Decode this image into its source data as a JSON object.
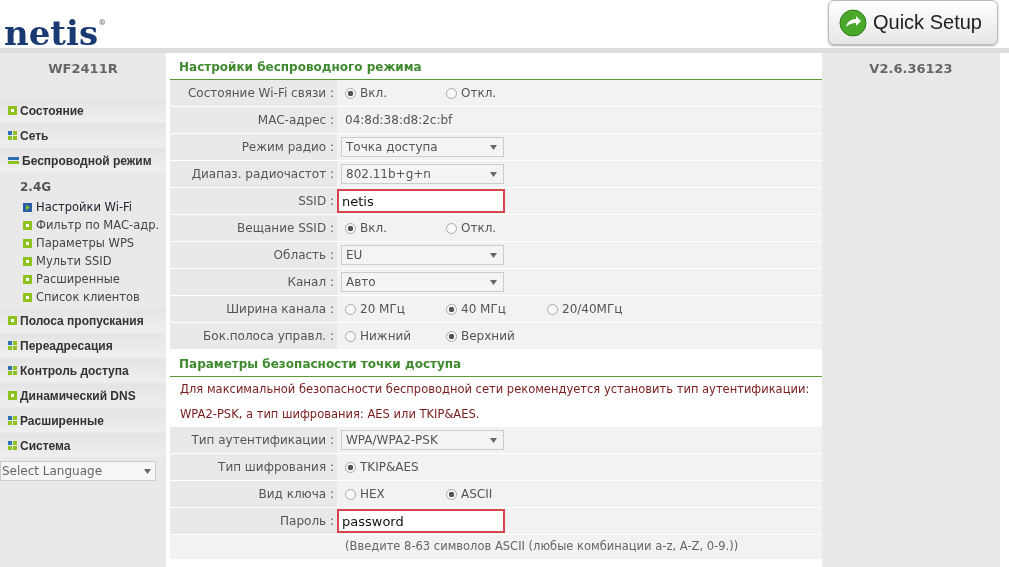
{
  "header": {
    "logo": "netis$^{®}$",
    "quick_setup": "Quick Setup"
  },
  "sidebar": {
    "model": "WF2411R",
    "items": [
      {
        "label": "Состояние",
        "kind": "leaf"
      },
      {
        "label": "Сеть",
        "kind": "group",
        "expanded": false
      },
      {
        "label": "Беспроводной режим",
        "kind": "group",
        "expanded": true,
        "band": "2.4G",
        "children": [
          {
            "label": "Настройки Wi-Fi",
            "selected": true
          },
          {
            "label": "Фильтр по MAC-адр.",
            "selected": false
          },
          {
            "label": "Параметры WPS",
            "selected": false
          },
          {
            "label": "Мульти SSID",
            "selected": false
          },
          {
            "label": "Расширенные",
            "selected": false
          },
          {
            "label": "Список клиентов",
            "selected": false
          }
        ]
      },
      {
        "label": "Полоса пропускания",
        "kind": "leaf"
      },
      {
        "label": "Переадресация",
        "kind": "group",
        "expanded": false
      },
      {
        "label": "Контроль доступа",
        "kind": "group",
        "expanded": false
      },
      {
        "label": "Динамический DNS",
        "kind": "leaf"
      },
      {
        "label": "Расширенные",
        "kind": "group",
        "expanded": false
      },
      {
        "label": "Система",
        "kind": "group",
        "expanded": false
      }
    ],
    "language": "Select Language"
  },
  "version": "V2.6.36123",
  "sections": [
    {
      "title": "Настройки беспроводного режима",
      "rows": [
        {
          "label": "Состояние Wi-Fi связи :",
          "kind": "radio",
          "options": [
            {
              "label": "Вкл.",
              "selected": true
            },
            {
              "label": "Откл.",
              "selected": false
            }
          ]
        },
        {
          "label": "MAC-адрес :",
          "kind": "text",
          "value": "04:8d:38:d8:2c:bf"
        },
        {
          "label": "Режим радио :",
          "kind": "select",
          "value": "Точка доступа"
        },
        {
          "label": "Диапаз. радиочастот :",
          "kind": "select",
          "value": "802.11b+g+n"
        },
        {
          "label": "SSID :",
          "kind": "input",
          "value": "netis",
          "highlighted": true
        },
        {
          "label": "Вещание SSID :",
          "kind": "radio",
          "options": [
            {
              "label": "Вкл.",
              "selected": true
            },
            {
              "label": "Откл.",
              "selected": false
            }
          ]
        },
        {
          "label": "Область :",
          "kind": "select",
          "value": "EU"
        },
        {
          "label": "Канал :",
          "kind": "select",
          "value": "Авто"
        },
        {
          "label": "Ширина канала :",
          "kind": "radio",
          "options": [
            {
              "label": "20 МГц",
              "selected": false
            },
            {
              "label": "40 МГц",
              "selected": true
            },
            {
              "label": "20/40МГц",
              "selected": false
            }
          ]
        },
        {
          "label": "Бок.полоса управл. :",
          "kind": "radio",
          "options": [
            {
              "label": "Нижний",
              "selected": false
            },
            {
              "label": "Верхний",
              "selected": true
            }
          ]
        }
      ]
    },
    {
      "title": "Параметры безопасности точки доступа",
      "notice": [
        "Для максимальной безопасности беспроводной сети рекомендуется установить тип аутентификации:",
        "WPA2-PSK, а тип шифрования: AES или TKIP&AES."
      ],
      "rows": [
        {
          "label": "Тип аутентификации :",
          "kind": "select",
          "value": "WPA/WPA2-PSK"
        },
        {
          "label": "Тип шифрования :",
          "kind": "radio",
          "options": [
            {
              "label": "TKIP&AES",
              "selected": true
            }
          ]
        },
        {
          "label": "Вид ключа :",
          "kind": "radio",
          "options": [
            {
              "label": "HEX",
              "selected": false
            },
            {
              "label": "ASCII",
              "selected": true
            }
          ]
        },
        {
          "label": "Пароль :",
          "kind": "input",
          "value": "password",
          "highlighted": true,
          "hint": "(Введите 8-63 символов ASCII (любые комбинации a-z, A-Z, 0-9.))"
        }
      ]
    }
  ]
}
